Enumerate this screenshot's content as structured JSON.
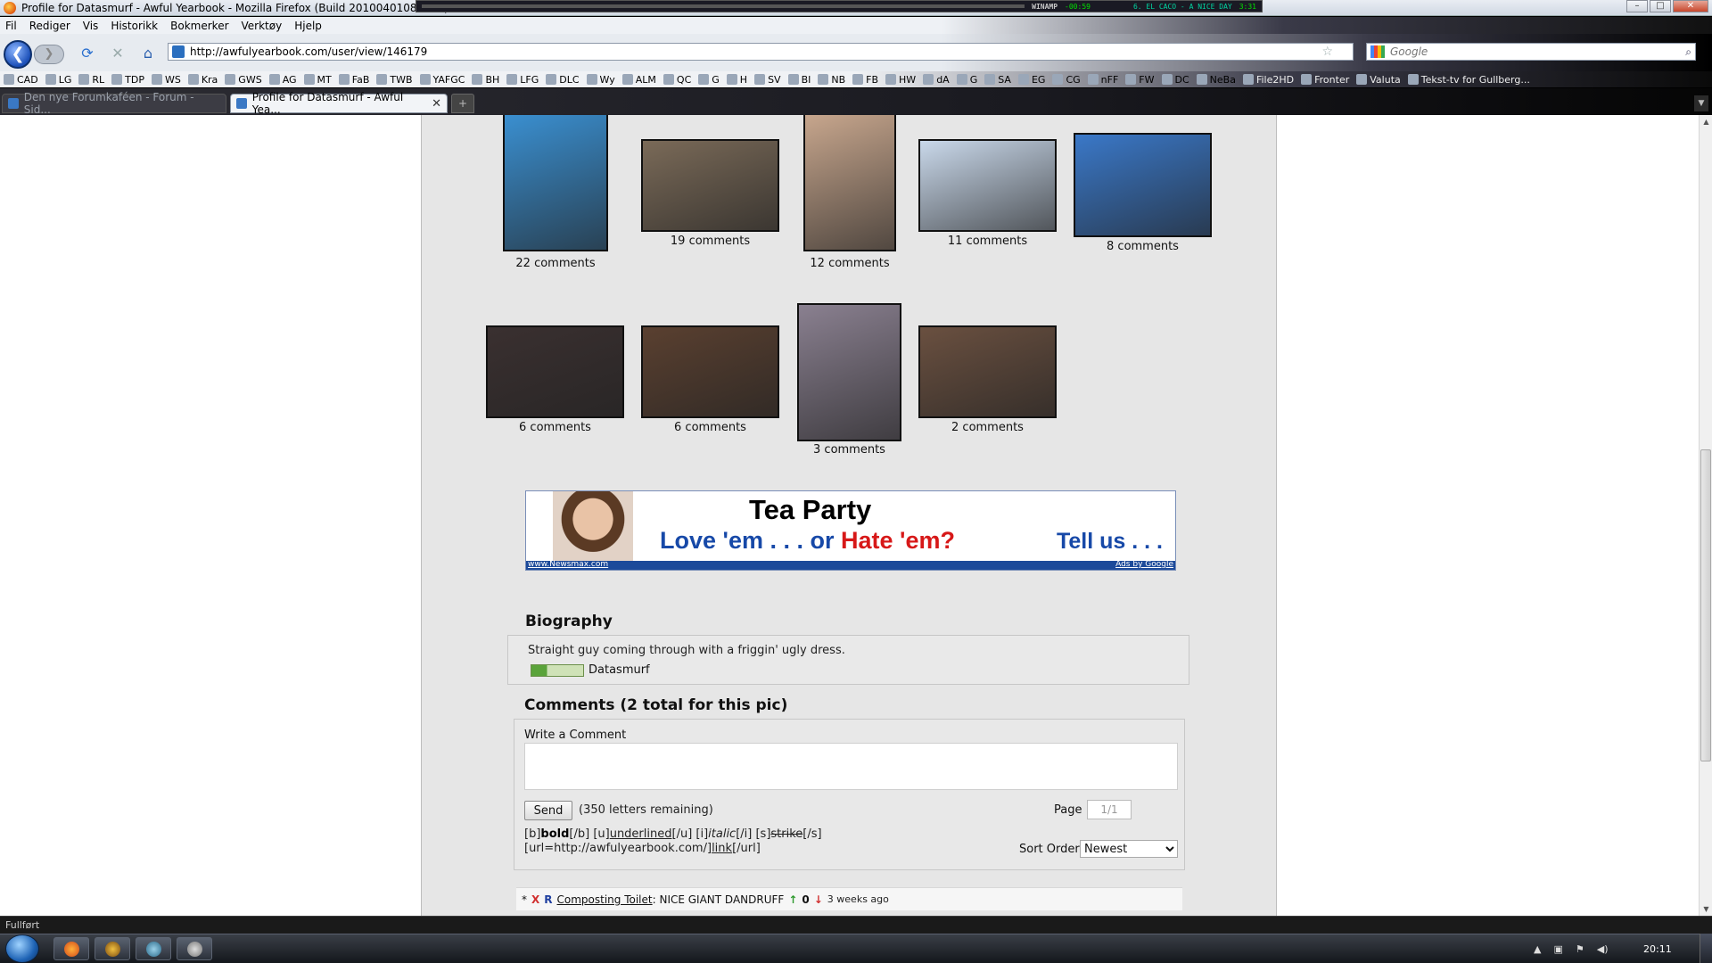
{
  "window": {
    "title": "Profile for Datasmurf - Awful Yearbook - Mozilla Firefox (Build 20100401080539)",
    "winamp": {
      "label": "WINAMP",
      "time": "-00:59",
      "track": "6. EL CACO - A NICE DAY",
      "track_time": "3:31"
    }
  },
  "menu": [
    "Fil",
    "Rediger",
    "Vis",
    "Historikk",
    "Bokmerker",
    "Verktøy",
    "Hjelp"
  ],
  "nav": {
    "url": "http://awfulyearbook.com/user/view/146179",
    "search_placeholder": "Google"
  },
  "bookmarks": [
    "CAD",
    "LG",
    "RL",
    "TDP",
    "WS",
    "Kra",
    "GWS",
    "AG",
    "MT",
    "FaB",
    "TWB",
    "YAFGC",
    "BH",
    "LFG",
    "DLC",
    "Wy",
    "ALM",
    "QC",
    "G",
    "H",
    "SV",
    "BI",
    "NB",
    "FB",
    "HW",
    "dA",
    "G",
    "SA",
    "EG",
    "CG",
    "nFF",
    "FW",
    "DC",
    "NeBa",
    "File2HD",
    "Fronter",
    "Valuta",
    "Tekst-tv for Gullberg..."
  ],
  "tabs": [
    {
      "label": "Den nye Forumkaféen - Forum - Sid...",
      "active": false
    },
    {
      "label": "Profile for Datasmurf - Awful Yea...",
      "active": true
    }
  ],
  "photos": [
    {
      "caption": "22 comments",
      "tone": "#3a8fd0"
    },
    {
      "caption": "19 comments",
      "tone": "#7a6a58"
    },
    {
      "caption": "12 comments",
      "tone": "#c7a68d"
    },
    {
      "caption": "11 comments",
      "tone": "#c9d8ea"
    },
    {
      "caption": "8 comments",
      "tone": "#3a78c8"
    },
    {
      "caption": "6 comments",
      "tone": "#3a3030"
    },
    {
      "caption": "6 comments",
      "tone": "#5a4030"
    },
    {
      "caption": "3 comments",
      "tone": "#8a8090"
    },
    {
      "caption": "2 comments",
      "tone": "#6a5040"
    }
  ],
  "ad": {
    "headline": "Tea Party",
    "love": "Love 'em . . . or",
    "hate": "Hate 'em?",
    "cta": "Tell us . . .",
    "source": "www.Newsmax.com",
    "ads_by": "Ads by Google"
  },
  "biography": {
    "heading": "Biography",
    "text": "Straight guy coming through with a friggin' ugly dress.",
    "username": "Datasmurf"
  },
  "comments": {
    "heading": "Comments (2 total for this pic)",
    "write_label": "Write a Comment",
    "send": "Send",
    "remaining": "(350 letters remaining)",
    "page_label": "Page",
    "page_value": "1/1",
    "bbcode_line1_pre": "[b]",
    "bbcode_bold": "bold",
    "bbcode_line1_mid1": "[/b] [u]",
    "bbcode_underlined": "underlined",
    "bbcode_line1_mid2": "[/u] [i]",
    "bbcode_italic": "italic",
    "bbcode_line1_mid3": "[/i] [s]",
    "bbcode_strike": "strike",
    "bbcode_line1_end": "[/s]",
    "bbcode_line2_pre": "[url=http://awfulyearbook.com/]",
    "bbcode_link": "link",
    "bbcode_line2_end": "[/url]",
    "sort_label": "Sort Order",
    "sort_value": "Newest",
    "list": [
      {
        "prefix": "*",
        "delete": "X",
        "reply": "R",
        "user": "Composting Toilet",
        "text": ": NICE GIANT DANDRUFF",
        "score": "0",
        "when": "3 weeks ago"
      }
    ]
  },
  "status": "Fullført",
  "clock": "20:11"
}
